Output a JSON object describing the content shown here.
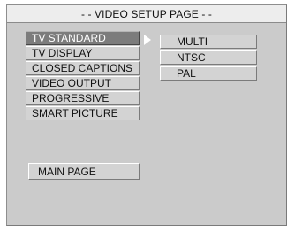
{
  "title": "- - VIDEO SETUP PAGE - -",
  "menu": {
    "items": [
      {
        "label": "TV STANDARD",
        "selected": true
      },
      {
        "label": "TV DISPLAY",
        "selected": false
      },
      {
        "label": "CLOSED CAPTIONS",
        "selected": false
      },
      {
        "label": "VIDEO OUTPUT",
        "selected": false
      },
      {
        "label": "PROGRESSIVE",
        "selected": false
      },
      {
        "label": "SMART PICTURE",
        "selected": false
      }
    ]
  },
  "submenu": {
    "options": [
      "MULTI",
      "NTSC",
      "PAL"
    ]
  },
  "main_page_label": "MAIN PAGE",
  "colors": {
    "frame": "#cbcbcb",
    "title_bar": "#ededed",
    "button": "#d3d3d3",
    "selected": "#7c7c7c",
    "selected_text": "#ffffff"
  }
}
